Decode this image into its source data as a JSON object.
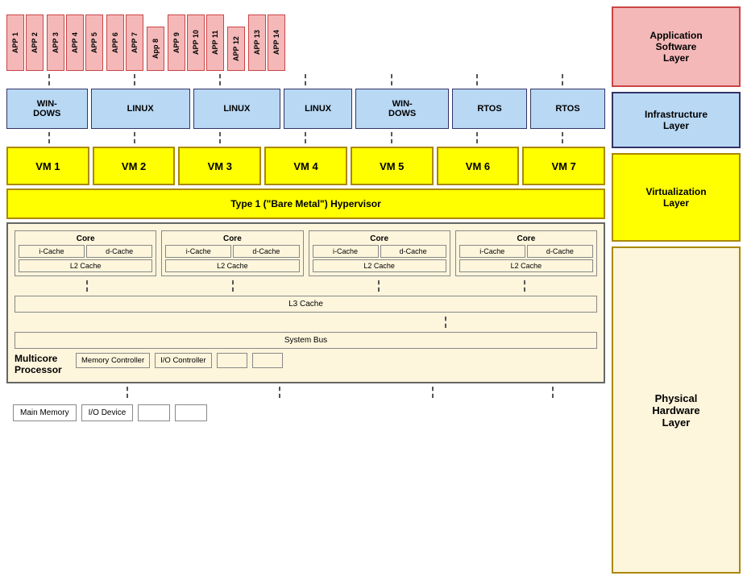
{
  "legend": {
    "app_layer": "Application\nSoftware\nLayer",
    "infra_layer": "Infrastructure\nLayer",
    "virt_layer": "Virtualization\nLayer",
    "phys_layer": "Physical\nHardware\nLayer"
  },
  "apps": {
    "groups": [
      [
        "APP 1",
        "APP 2"
      ],
      [
        "APP 3",
        "APP 4",
        "APP 5"
      ],
      [
        "APP 6",
        "APP 7"
      ],
      [
        "App 8"
      ],
      [
        "APP 9",
        "APP 10",
        "APP 11"
      ],
      [
        "APP 12"
      ],
      [
        "APP 13",
        "APP 14"
      ]
    ]
  },
  "os": {
    "items": [
      "WIN-\nDOWS",
      "LINUX",
      "LINUX",
      "LINUX",
      "WIN-\nDOWS",
      "RTOS",
      "RTOS"
    ]
  },
  "vms": {
    "items": [
      "VM 1",
      "VM 2",
      "VM 3",
      "VM 4",
      "VM 5",
      "VM 6",
      "VM 7"
    ]
  },
  "hypervisor": {
    "label": "Type 1 (\"Bare Metal\") Hypervisor"
  },
  "hardware": {
    "cores": [
      {
        "label": "Core",
        "caches": [
          "i-Cache",
          "d-Cache"
        ],
        "l2": "L2 Cache"
      },
      {
        "label": "Core",
        "caches": [
          "i-Cache",
          "d-Cache"
        ],
        "l2": "L2 Cache"
      },
      {
        "label": "Core",
        "caches": [
          "i-Cache",
          "d-Cache"
        ],
        "l2": "L2 Cache"
      },
      {
        "label": "Core",
        "caches": [
          "i-Cache",
          "d-Cache"
        ],
        "l2": "L2 Cache"
      }
    ],
    "l3": "L3 Cache",
    "sysbus": "System Bus",
    "multicore": "Multicore\nProcessor",
    "memory_ctrl": "Memory Controller",
    "io_ctrl": "I/O Controller",
    "main_memory": "Main Memory",
    "io_device": "I/O Device"
  }
}
